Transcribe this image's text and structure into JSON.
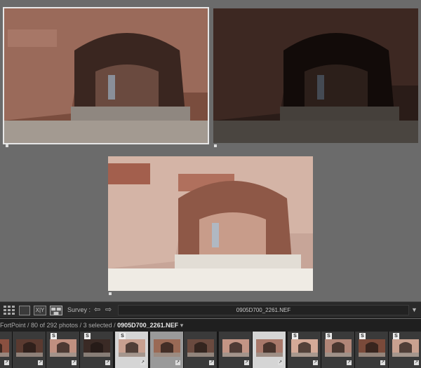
{
  "survey": {
    "photos": [
      {
        "name": "survey-photo-1",
        "tone": "normal"
      },
      {
        "name": "survey-photo-2",
        "tone": "dark"
      },
      {
        "name": "survey-photo-3",
        "tone": "bright"
      }
    ]
  },
  "toolbar": {
    "compare_label": "X|Y",
    "survey_label": "Survey :",
    "prev_arrow": "⇦",
    "next_arrow": "⇨",
    "filename": "0905D700_2261.NEF",
    "dropdown": "▼"
  },
  "filmstrip": {
    "folder": "FortPoint",
    "count_text": " / 80 of 292 photos / 3 selected / ",
    "current_file": "0905D700_2261.NEF",
    "dropdown": "▾",
    "badge_s": "S",
    "badge_edit": "↗"
  }
}
